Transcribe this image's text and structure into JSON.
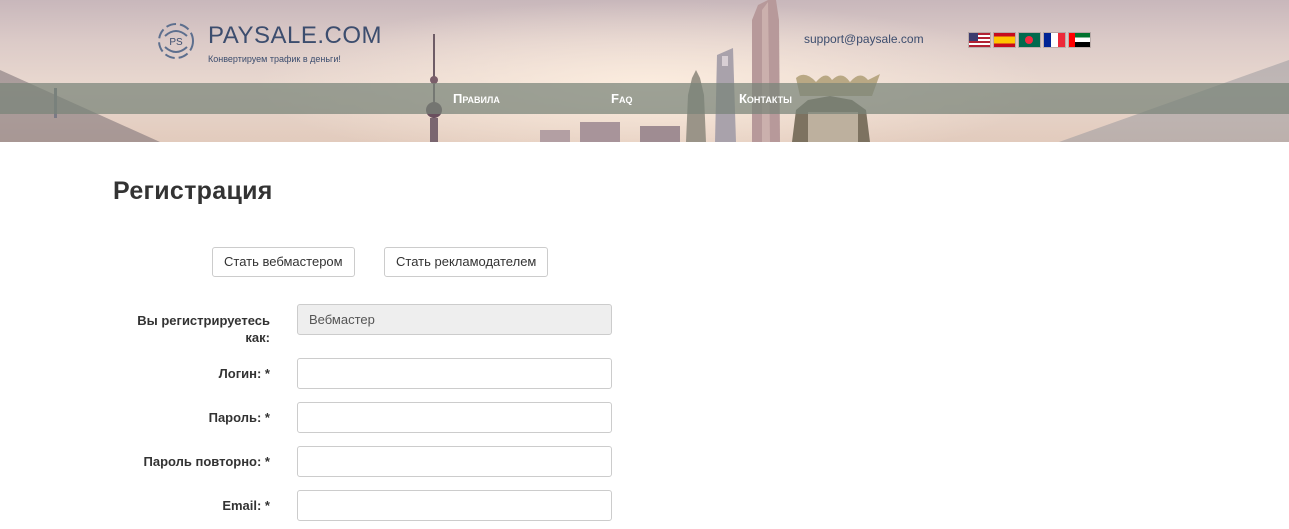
{
  "header": {
    "logo_title": "PAYSALE.COM",
    "logo_tagline": "Конвертируем трафик в деньги!",
    "support_email": "support@paysale.com",
    "languages": [
      {
        "code": "en",
        "icon": "flag-us-icon"
      },
      {
        "code": "es",
        "icon": "flag-es-icon"
      },
      {
        "code": "bd",
        "icon": "flag-bd-icon"
      },
      {
        "code": "fr",
        "icon": "flag-fr-icon"
      },
      {
        "code": "ae",
        "icon": "flag-ae-icon"
      }
    ]
  },
  "nav": {
    "items": [
      {
        "label": "Правила"
      },
      {
        "label": "Faq"
      },
      {
        "label": "Контакты"
      }
    ]
  },
  "page": {
    "title": "Регистрация"
  },
  "role_buttons": {
    "webmaster": "Стать вебмастером",
    "advertiser": "Стать рекламодателем"
  },
  "form": {
    "role": {
      "label": "Вы регистрируетесь как:",
      "value": "Вебмастер"
    },
    "login": {
      "label": "Логин: *",
      "value": ""
    },
    "password": {
      "label": "Пароль: *",
      "value": ""
    },
    "password_repeat": {
      "label": "Пароль повторно: *",
      "value": ""
    },
    "email": {
      "label": "Email: *",
      "value": ""
    }
  },
  "colors": {
    "brand": "#3c4d6e",
    "navbar": "#788478"
  }
}
